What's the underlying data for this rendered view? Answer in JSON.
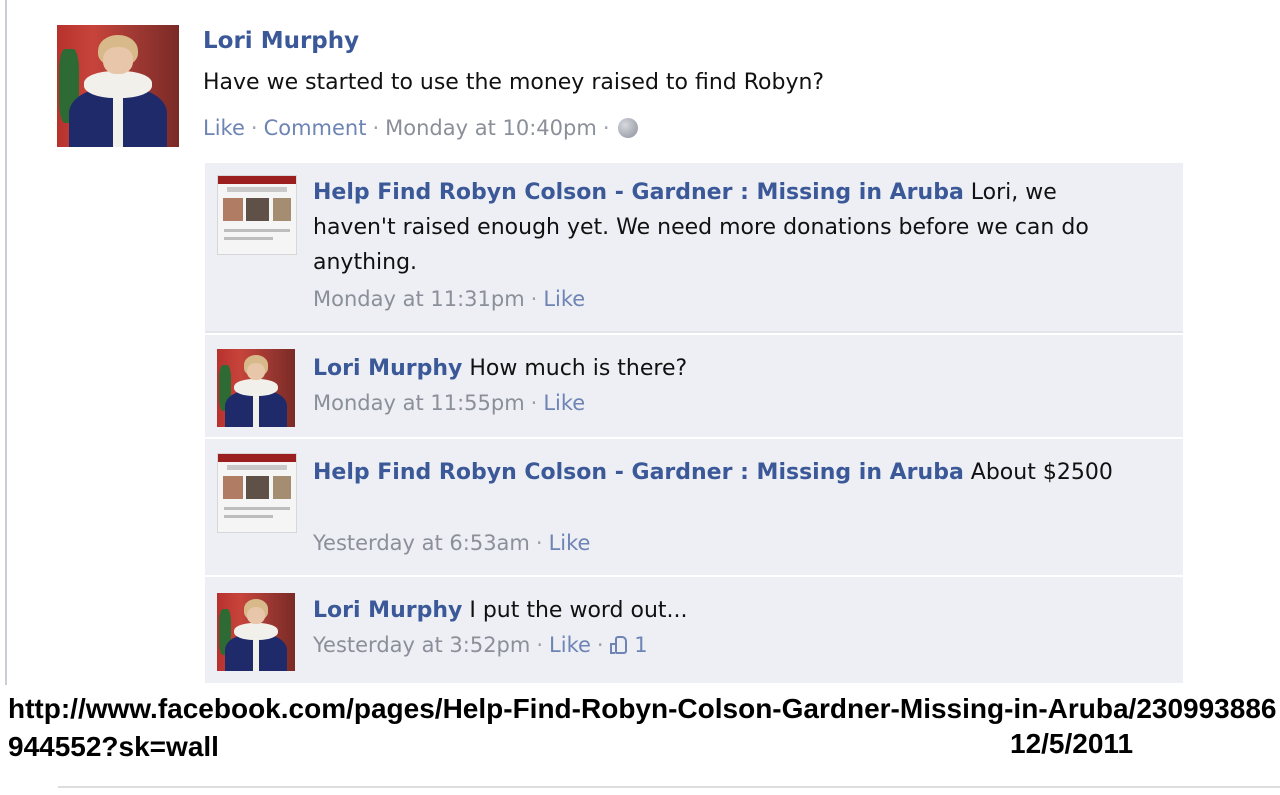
{
  "post": {
    "author": "Lori Murphy",
    "text": "Have we started to use the money raised to find Robyn?",
    "actions": {
      "like": "Like",
      "comment": "Comment"
    },
    "timestamp": "Monday at 10:40pm",
    "privacy_icon": "globe-icon"
  },
  "comments": [
    {
      "author": "Help Find Robyn Colson - Gardner : Missing in Aruba",
      "text": "Lori, we haven't raised enough yet. We need more donations before we can do anything.",
      "timestamp": "Monday at 11:31pm",
      "like": "Like"
    },
    {
      "author": "Lori Murphy",
      "text": "How much is there?",
      "timestamp": "Monday at 11:55pm",
      "like": "Like"
    },
    {
      "author": "Help Find Robyn Colson - Gardner : Missing in Aruba",
      "text": "About $2500",
      "timestamp": "Yesterday at 6:53am",
      "like": "Like"
    },
    {
      "author": "Lori Murphy",
      "text": "I put the word out...",
      "timestamp": "Yesterday at 3:52pm",
      "like": "Like",
      "like_count": "1"
    }
  ],
  "source": {
    "url": "http://www.facebook.com/pages/Help-Find-Robyn-Colson-Gardner-Missing-in-Aruba/230993886944552?sk=wall",
    "date": "12/5/2011"
  },
  "colors": {
    "name_link": "#3b5998",
    "action_link": "#6d84b4",
    "meta_gray": "#8a8f99",
    "comment_bg": "#edeff4"
  }
}
